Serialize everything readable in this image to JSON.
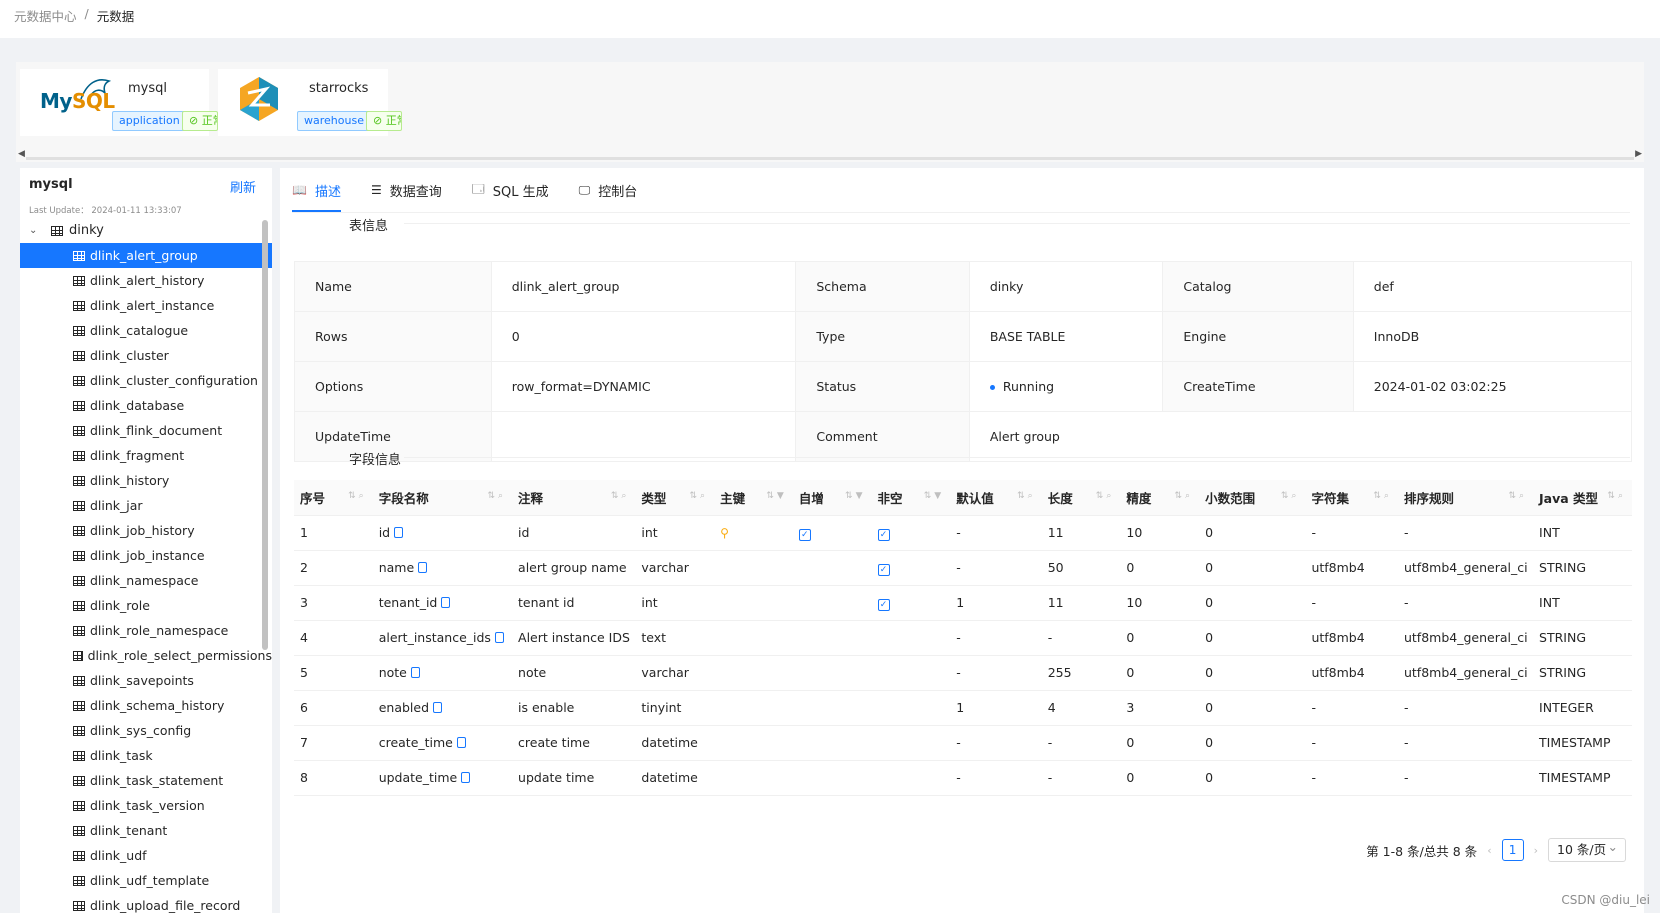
{
  "breadcrumb": {
    "root": "元数据中心",
    "sep": "/",
    "current": "元数据"
  },
  "datasources": [
    {
      "name": "mysql",
      "tag": "application",
      "status": "正常"
    },
    {
      "name": "starrocks",
      "tag": "warehouse",
      "status": "正常"
    }
  ],
  "sidebar": {
    "title": "mysql",
    "refresh": "刷新",
    "last_update": "Last Update： 2024-01-11 13:33:07",
    "database": "dinky",
    "tables": [
      "dlink_alert_group",
      "dlink_alert_history",
      "dlink_alert_instance",
      "dlink_catalogue",
      "dlink_cluster",
      "dlink_cluster_configuration",
      "dlink_database",
      "dlink_flink_document",
      "dlink_fragment",
      "dlink_history",
      "dlink_jar",
      "dlink_job_history",
      "dlink_job_instance",
      "dlink_namespace",
      "dlink_role",
      "dlink_role_namespace",
      "dlink_role_select_permissions",
      "dlink_savepoints",
      "dlink_schema_history",
      "dlink_sys_config",
      "dlink_task",
      "dlink_task_statement",
      "dlink_task_version",
      "dlink_tenant",
      "dlink_udf",
      "dlink_udf_template",
      "dlink_upload_file_record"
    ]
  },
  "tabs": [
    {
      "label": "描述",
      "icon": "book-icon",
      "glyph": "📖"
    },
    {
      "label": "数据查询",
      "icon": "list-icon",
      "glyph": "☰"
    },
    {
      "label": "SQL 生成",
      "icon": "sql-icon",
      "glyph": "🗔"
    },
    {
      "label": "控制台",
      "icon": "console-icon",
      "glyph": "🖵"
    }
  ],
  "table_info": {
    "title": "表信息",
    "rows": [
      [
        [
          "Name",
          "dlink_alert_group"
        ],
        [
          "Schema",
          "dinky"
        ],
        [
          "Catalog",
          "def"
        ]
      ],
      [
        [
          "Rows",
          "0"
        ],
        [
          "Type",
          "BASE TABLE"
        ],
        [
          "Engine",
          "InnoDB"
        ]
      ],
      [
        [
          "Options",
          "row_format=DYNAMIC"
        ],
        [
          "Status",
          "Running"
        ],
        [
          "CreateTime",
          "2024-01-02 03:02:25"
        ]
      ],
      [
        [
          "UpdateTime",
          ""
        ],
        [
          "Comment",
          "Alert group"
        ]
      ]
    ]
  },
  "field_info": {
    "title": "字段信息",
    "columns": [
      "序号",
      "字段名称",
      "注释",
      "类型",
      "主键",
      "自增",
      "非空",
      "默认值",
      "长度",
      "精度",
      "小数范围",
      "字符集",
      "排序规则",
      "Java 类型"
    ],
    "rows": [
      [
        "1",
        "id",
        "id",
        "int",
        "key",
        "chk",
        "chk",
        "-",
        "11",
        "10",
        "0",
        "-",
        "-",
        "INT"
      ],
      [
        "2",
        "name",
        "alert group name",
        "varchar",
        "",
        "",
        "chk",
        "-",
        "50",
        "0",
        "0",
        "utf8mb4",
        "utf8mb4_general_ci",
        "STRING"
      ],
      [
        "3",
        "tenant_id",
        "tenant id",
        "int",
        "",
        "",
        "chk",
        "1",
        "11",
        "10",
        "0",
        "-",
        "-",
        "INT"
      ],
      [
        "4",
        "alert_instance_ids",
        "Alert instance IDS",
        "text",
        "",
        "",
        "",
        "-",
        "-",
        "0",
        "0",
        "utf8mb4",
        "utf8mb4_general_ci",
        "STRING"
      ],
      [
        "5",
        "note",
        "note",
        "varchar",
        "",
        "",
        "",
        "-",
        "255",
        "0",
        "0",
        "utf8mb4",
        "utf8mb4_general_ci",
        "STRING"
      ],
      [
        "6",
        "enabled",
        "is enable",
        "tinyint",
        "",
        "",
        "",
        "1",
        "4",
        "3",
        "0",
        "-",
        "-",
        "INTEGER"
      ],
      [
        "7",
        "create_time",
        "create time",
        "datetime",
        "",
        "",
        "",
        "-",
        "-",
        "0",
        "0",
        "-",
        "-",
        "TIMESTAMP"
      ],
      [
        "8",
        "update_time",
        "update time",
        "datetime",
        "",
        "",
        "",
        "-",
        "-",
        "0",
        "0",
        "-",
        "-",
        "TIMESTAMP"
      ]
    ]
  },
  "pagination": {
    "summary": "第 1-8 条/总共 8 条",
    "page": "1",
    "page_size": "10 条/页"
  },
  "watermark": "CSDN @diu_lei",
  "colors": {
    "accent": "#1677ff",
    "success": "#52c41a",
    "warning": "#faad14"
  }
}
